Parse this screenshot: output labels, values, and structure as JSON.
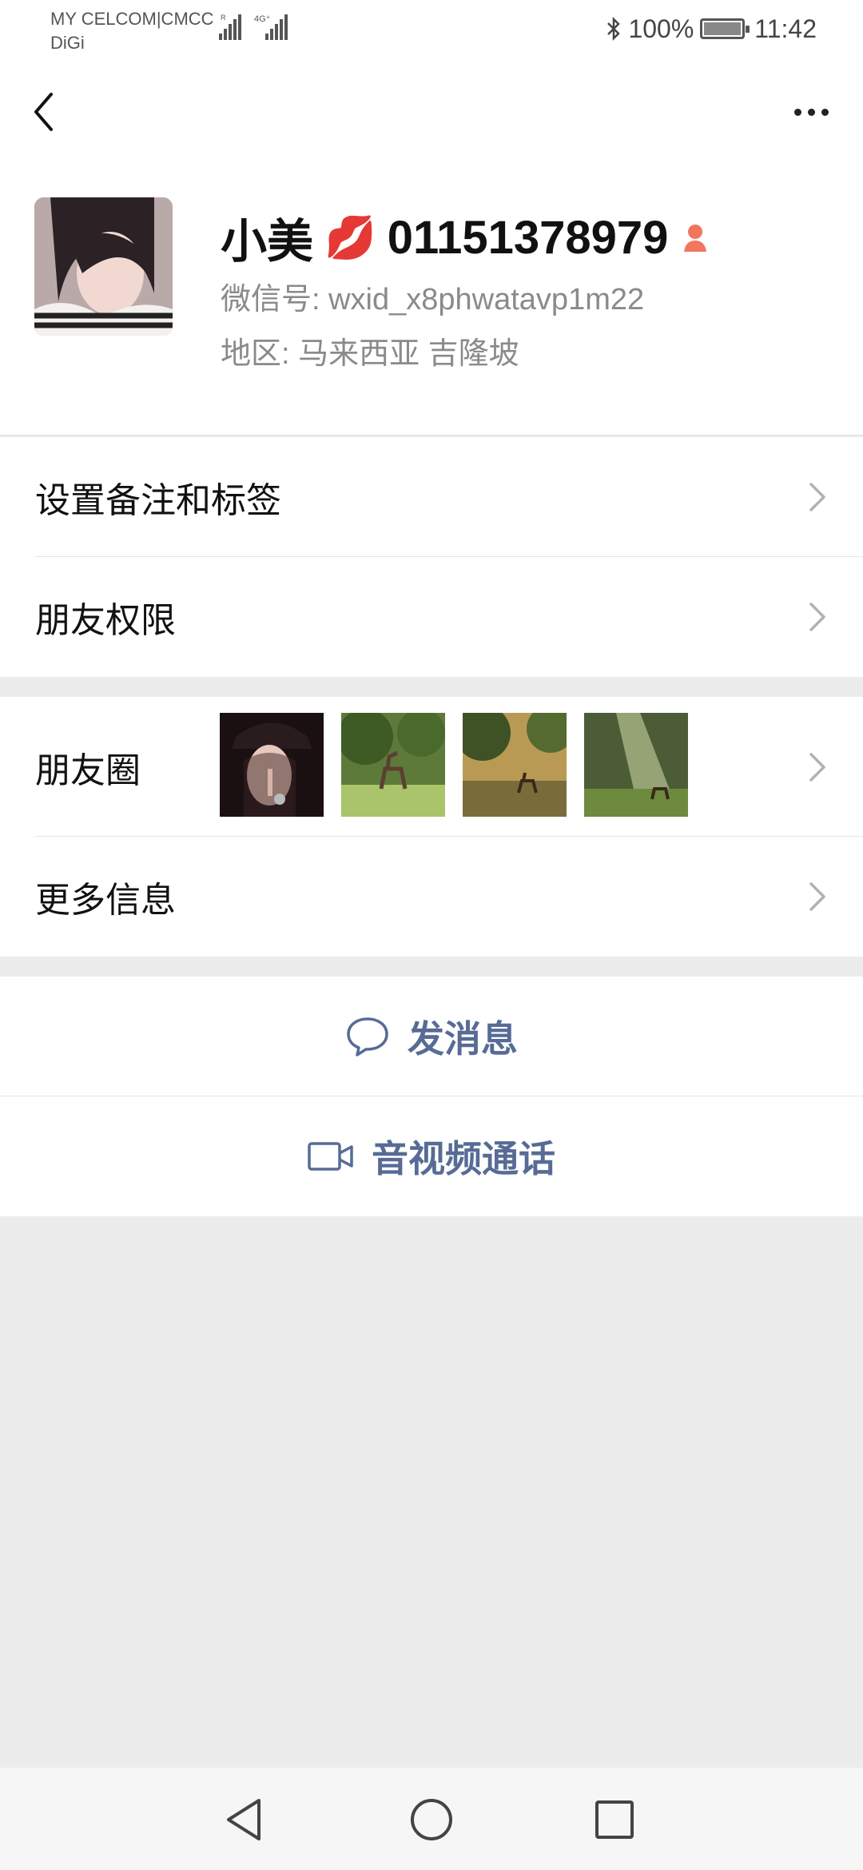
{
  "status_bar": {
    "carrier_line1": "MY CELCOM|CMCC",
    "carrier_line2": "DiGi",
    "network": "4G+",
    "battery": "100%",
    "time": "11:42"
  },
  "header": {
    "back_icon": "chevron-left-icon",
    "more_icon": "more-dots-icon"
  },
  "profile": {
    "name_prefix": "小美",
    "name_emoji": "💋",
    "name_suffix": "01151378979",
    "gender_icon": "female-icon",
    "wechat_id": "微信号: wxid_x8phwatavp1m22",
    "region": "地区: 马来西亚  吉隆坡"
  },
  "menu": {
    "remark_tags": "设置备注和标签",
    "friend_permissions": "朋友权限",
    "moments": "朋友圈",
    "more_info": "更多信息"
  },
  "actions": {
    "send_message": "发消息",
    "video_call": "音视频通话"
  },
  "colors": {
    "accent": "#576b95",
    "background": "#ececec",
    "gender": "#f0775c"
  }
}
